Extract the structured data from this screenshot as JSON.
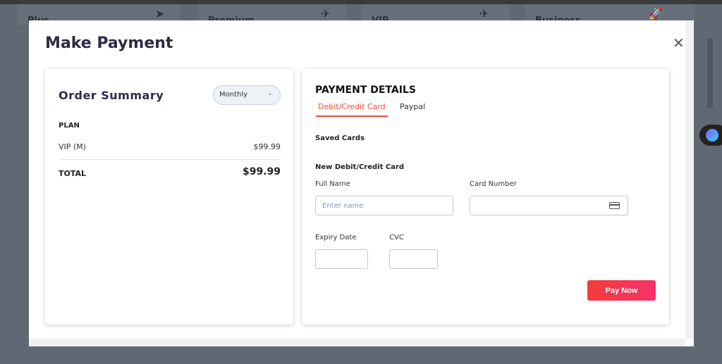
{
  "background": {
    "plans": [
      "Plus",
      "Premium",
      "VIP",
      "Business"
    ]
  },
  "modal": {
    "title": "Make Payment",
    "close_icon": "close-icon"
  },
  "order": {
    "title": "Order Summary",
    "billing": "Monthly",
    "plan_label": "PLAN",
    "plan_name": "VIP (M)",
    "plan_price": "$99.99",
    "total_label": "TOTAL",
    "total_value": "$99.99"
  },
  "payment": {
    "title": "PAYMENT DETAILS",
    "tabs": [
      "Debit/Credit Card",
      "Paypal"
    ],
    "saved_cards": "Saved Cards",
    "new_card": "New Debit/Credit Card",
    "full_name_label": "Full Name",
    "full_name_placeholder": "Enter name",
    "card_number_label": "Card Number",
    "expiry_label": "Expiry Date",
    "cvc_label": "CVC",
    "pay_button": "Pay Now"
  },
  "colors": {
    "accent": "#f24b3b",
    "overlay": "#5f6974"
  }
}
